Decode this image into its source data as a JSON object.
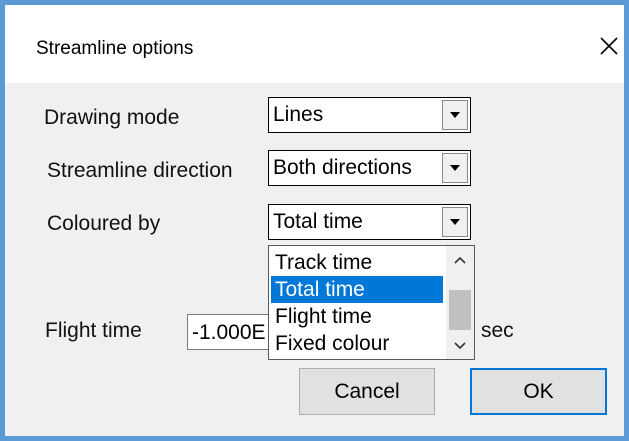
{
  "dialog": {
    "title": "Streamline options",
    "close_glyph": "✕"
  },
  "fields": {
    "drawing_mode": {
      "label": "Drawing mode",
      "value": "Lines"
    },
    "direction": {
      "label": "Streamline direction",
      "value": "Both directions"
    },
    "coloured_by": {
      "label": "Coloured by",
      "value": "Total time"
    },
    "flight_time": {
      "label": "Flight time",
      "value": "-1.000E",
      "unit": "sec"
    }
  },
  "dropdown": {
    "options": [
      "Track time",
      "Total time",
      "Flight time",
      "Fixed colour"
    ],
    "selected_index": 1
  },
  "buttons": {
    "cancel": "Cancel",
    "ok": "OK"
  },
  "colors": {
    "accent": "#0078d7",
    "window_border": "#5b9bd5"
  },
  "icons": {
    "close": "close-icon",
    "dropdown": "chevron-down-icon",
    "scroll_up": "chevron-up-icon",
    "scroll_down": "chevron-down-icon"
  }
}
